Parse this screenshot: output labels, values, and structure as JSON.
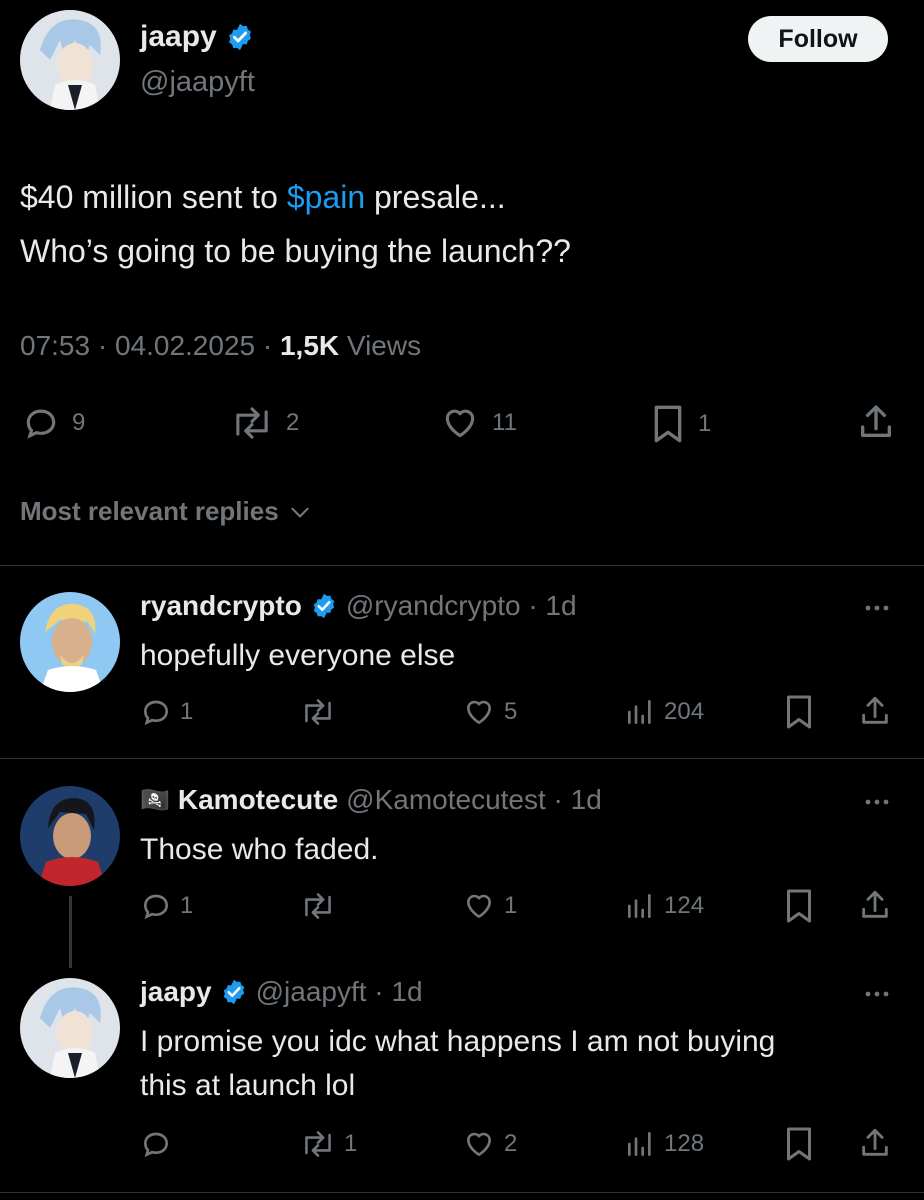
{
  "main": {
    "name": "jaapy",
    "handle": "@jaapyft",
    "follow_label": "Follow",
    "text_pre": "$40 million sent to ",
    "cashtag": "$pain",
    "text_post": " presale...",
    "text_line2": "Who’s going to be buying the launch??",
    "time": "07:53 · 04.02.2025 · ",
    "views_count": "1,5K",
    "views_label": " Views",
    "replies": "9",
    "reposts": "2",
    "likes": "11",
    "bookmarks": "1"
  },
  "sort_label": "Most relevant replies",
  "replies": [
    {
      "name": "ryandcrypto",
      "handle": "@ryandcrypto · 1d",
      "text": "hopefully everyone else",
      "replies": "1",
      "reposts": "",
      "likes": "5",
      "views": "204"
    },
    {
      "flag": "🏴‍☠️",
      "name": "Kamotecute",
      "handle": "@Kamotecutest · 1d",
      "text": "Those who faded.",
      "replies": "1",
      "reposts": "",
      "likes": "1",
      "views": "124"
    },
    {
      "name": "jaapy",
      "handle": "@jaapyft · 1d",
      "text_line1": "I promise you idc what happens I am not buying",
      "text_line2": "this at launch lol",
      "replies": "",
      "reposts": "1",
      "likes": "2",
      "views": "128"
    }
  ],
  "colors": {
    "background": "#000000",
    "text": "#e7e9ea",
    "secondary": "#71767b",
    "link": "#1d9bf0",
    "verified": "#1d9bf0"
  }
}
